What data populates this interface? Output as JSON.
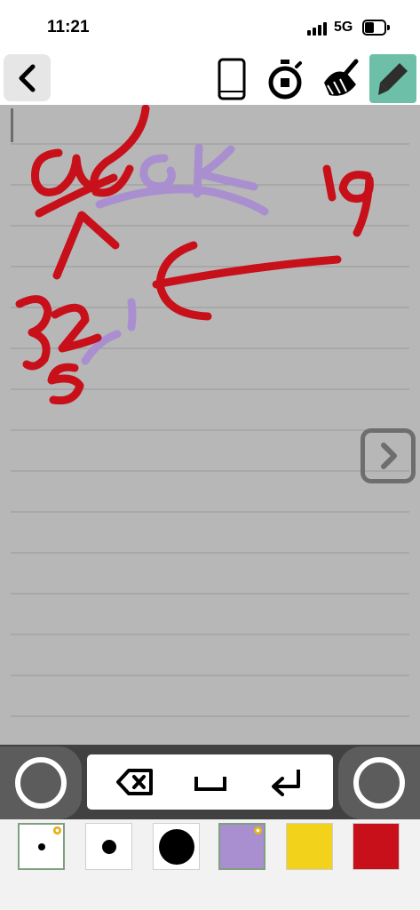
{
  "status_bar": {
    "time": "11:21",
    "network": "5G"
  },
  "toolbar": {
    "back_icon": "chevron-left-icon",
    "tools": [
      "phone-icon",
      "stopwatch-icon",
      "broom-icon",
      "pencil-icon"
    ],
    "active_tool": "pencil-icon",
    "active_color": "#6dbfa7"
  },
  "canvas": {
    "background": "#b7b7b7",
    "ruled_lines": 15,
    "handwriting": [
      "Ud",
      "GK",
      "19",
      "32",
      "5",
      "E"
    ],
    "ink_colors": [
      "#c8101a",
      "#a98fd0"
    ],
    "next_icon": "chevron-right-icon"
  },
  "keyboard": {
    "keys": [
      "backspace-icon",
      "space-icon",
      "enter-icon"
    ]
  },
  "swatches": [
    {
      "kind": "pen-size-small",
      "selected": true,
      "gear": true
    },
    {
      "kind": "pen-size-medium",
      "selected": false,
      "gear": false
    },
    {
      "kind": "pen-size-large",
      "selected": false,
      "gear": false
    },
    {
      "kind": "color",
      "color": "#a98fd0",
      "selected": true,
      "gear": true
    },
    {
      "kind": "color",
      "color": "#f2d21b",
      "selected": false,
      "gear": false
    },
    {
      "kind": "color",
      "color": "#c8101a",
      "selected": false,
      "gear": false
    }
  ]
}
